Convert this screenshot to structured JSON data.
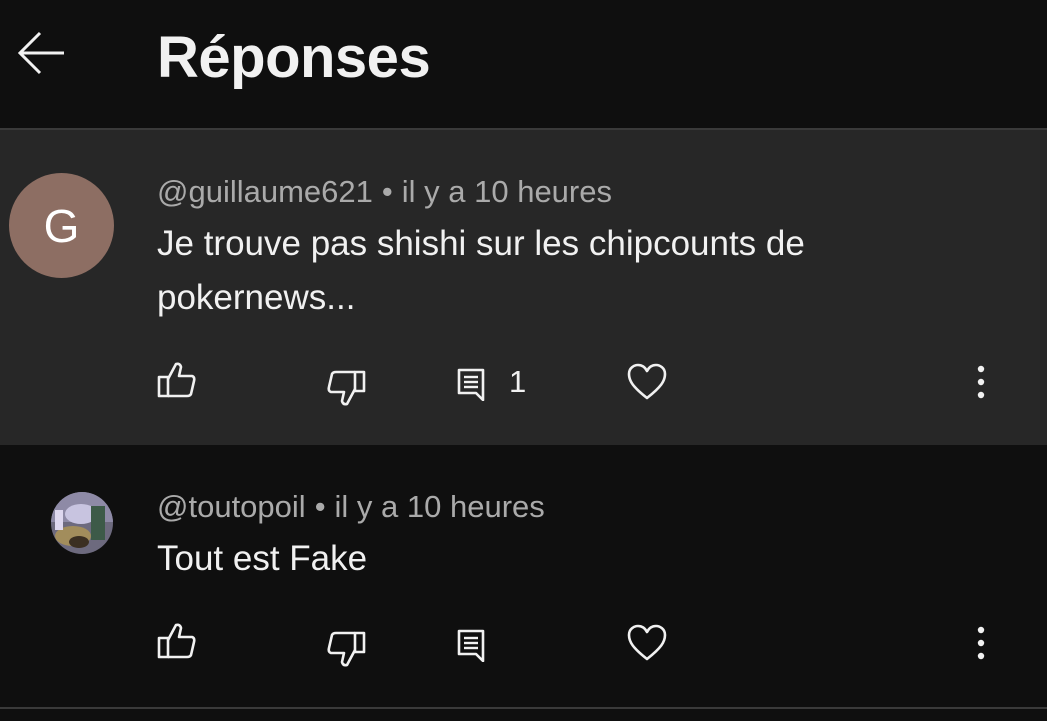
{
  "header": {
    "title": "Réponses"
  },
  "icons": {
    "back": "arrow-left-icon",
    "like": "thumb-up-icon",
    "dislike": "thumb-down-icon",
    "reply": "comment-icon",
    "heart": "heart-icon",
    "more": "more-vertical-icon"
  },
  "colors": {
    "background": "#0f0f0f",
    "highlighted_comment_bg": "#272727",
    "avatar_g": "#8d6e63",
    "secondary_text": "#aaaaaa",
    "primary_text": "#f1f1f1"
  },
  "comments": [
    {
      "avatar_letter": "G",
      "author": "@guillaume621",
      "separator": "•",
      "time": "il y a 10 heures",
      "text_line1": "Je trouve pas shishi sur les chipcounts de",
      "text_line2": "pokernews...",
      "reply_count": "1"
    },
    {
      "author": "@toutopoil",
      "separator": "•",
      "time": "il y a 10 heures",
      "text_line1": "Tout est Fake"
    }
  ]
}
